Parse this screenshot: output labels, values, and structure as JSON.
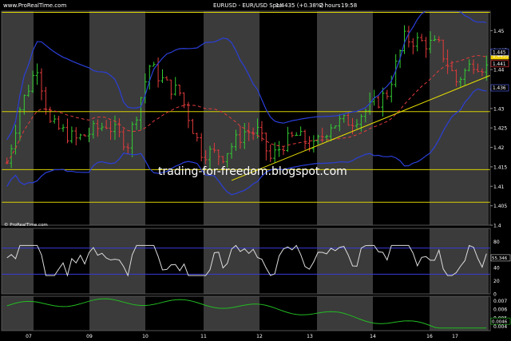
{
  "header": {
    "watermark_top": "www.ProRealTime.com",
    "title": "EURUSD - EUR/USD Spot",
    "price_change": "1.4435 (+0.38%)",
    "timeframe": "2 hours",
    "time": "19:58"
  },
  "colors": {
    "background": "#000000",
    "band_light": "#3b3b3b",
    "band_dark": "#000000",
    "candle_up": "#33cc33",
    "candle_down": "#e23b3b",
    "bollinger": "#2b3fd8",
    "ma": "#e23b3b",
    "hlines": "#d8d000",
    "trendline": "#e8e000",
    "rsi": "#dcdcdc",
    "rsi_levels": "#3a3ad8",
    "macd": "#22bb22",
    "axis_text": "#ffffff"
  },
  "watermark_bottom": "© ProRealTime.com",
  "blog_watermark": "trading-for-freedom.blogspot.com",
  "chart_data": [
    {
      "type": "candlestick",
      "title": "EURUSD - EUR/USD Spot",
      "ylim": [
        1.4,
        1.455
      ],
      "yticks": [
        "1.45",
        "1.445",
        "1.44",
        "1.435",
        "1.43",
        "1.425",
        "1.42",
        "1.415",
        "1.41",
        "1.405",
        "1.4"
      ],
      "price_labels": [
        {
          "value": 1.4435,
          "label": "1.4435",
          "style": "highlight"
        },
        {
          "value": 1.4445,
          "label": "1.445",
          "style": "box-blue"
        },
        {
          "value": 1.4415,
          "label": "1.441",
          "style": "box-red"
        },
        {
          "value": 1.4353,
          "label": "1.436",
          "style": "box-blue"
        }
      ],
      "horizontal_lines": [
        1.4547,
        1.4292,
        1.4143,
        1.4059
      ],
      "trendline": {
        "from": {
          "bar": 52,
          "value": 1.4115
        },
        "to": {
          "bar": 103,
          "value": 1.4385
        }
      },
      "grid": false
    },
    {
      "type": "line",
      "indicator": "RSI",
      "ylim": [
        0,
        100
      ],
      "yticks": [
        "80",
        "40",
        "20",
        "0"
      ],
      "levels": [
        70,
        30
      ],
      "last_value_label": "55.346"
    },
    {
      "type": "line",
      "indicator": "MACD",
      "ylim": [
        0.0035,
        0.0075
      ],
      "yticks": [
        "0.007",
        "0.006",
        "0.005",
        "0.004"
      ],
      "last_value_label": "0.0046"
    }
  ],
  "x_axis_labels": [
    "07",
    "09",
    "10",
    "11",
    "12",
    "13",
    "14",
    "16",
    "17"
  ]
}
